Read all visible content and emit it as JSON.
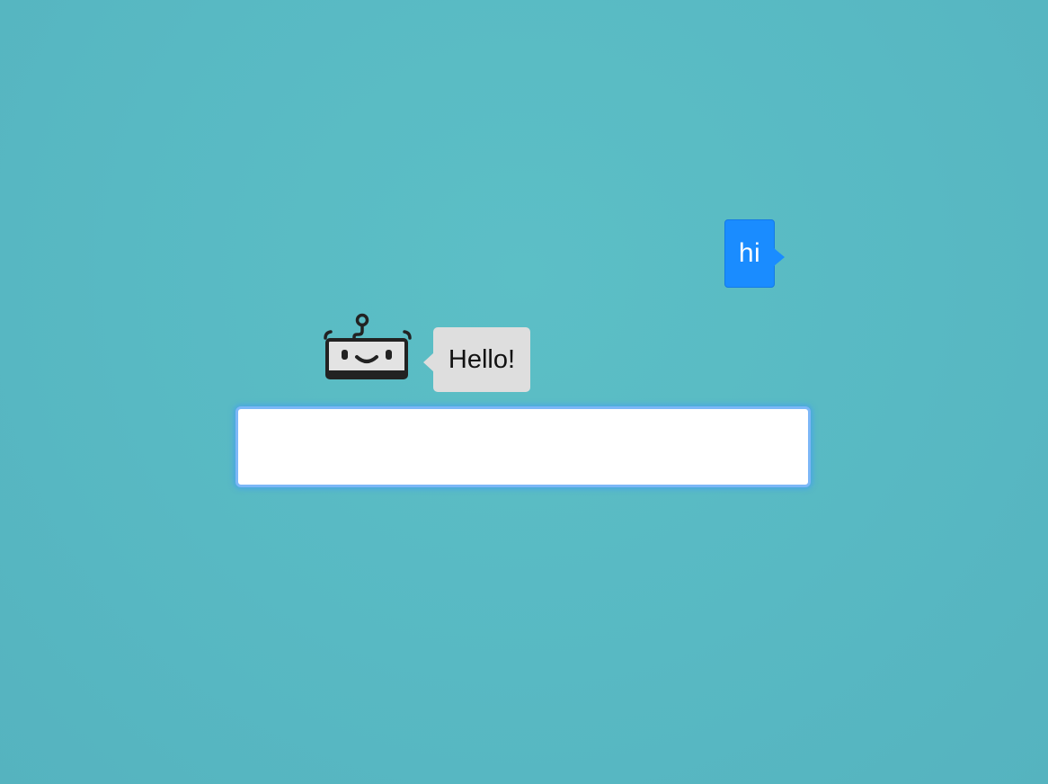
{
  "conversation": {
    "messages": [
      {
        "sender": "user",
        "text": "hi"
      },
      {
        "sender": "bot",
        "text": "Hello!"
      }
    ]
  },
  "avatar": {
    "icon": "robot-face-icon"
  },
  "composer": {
    "value": "",
    "placeholder": ""
  },
  "colors": {
    "background": "#5bbcc4",
    "user_bubble": "#1a8cff",
    "bot_bubble": "#dedede",
    "input_focus": "#7cb7f7"
  }
}
